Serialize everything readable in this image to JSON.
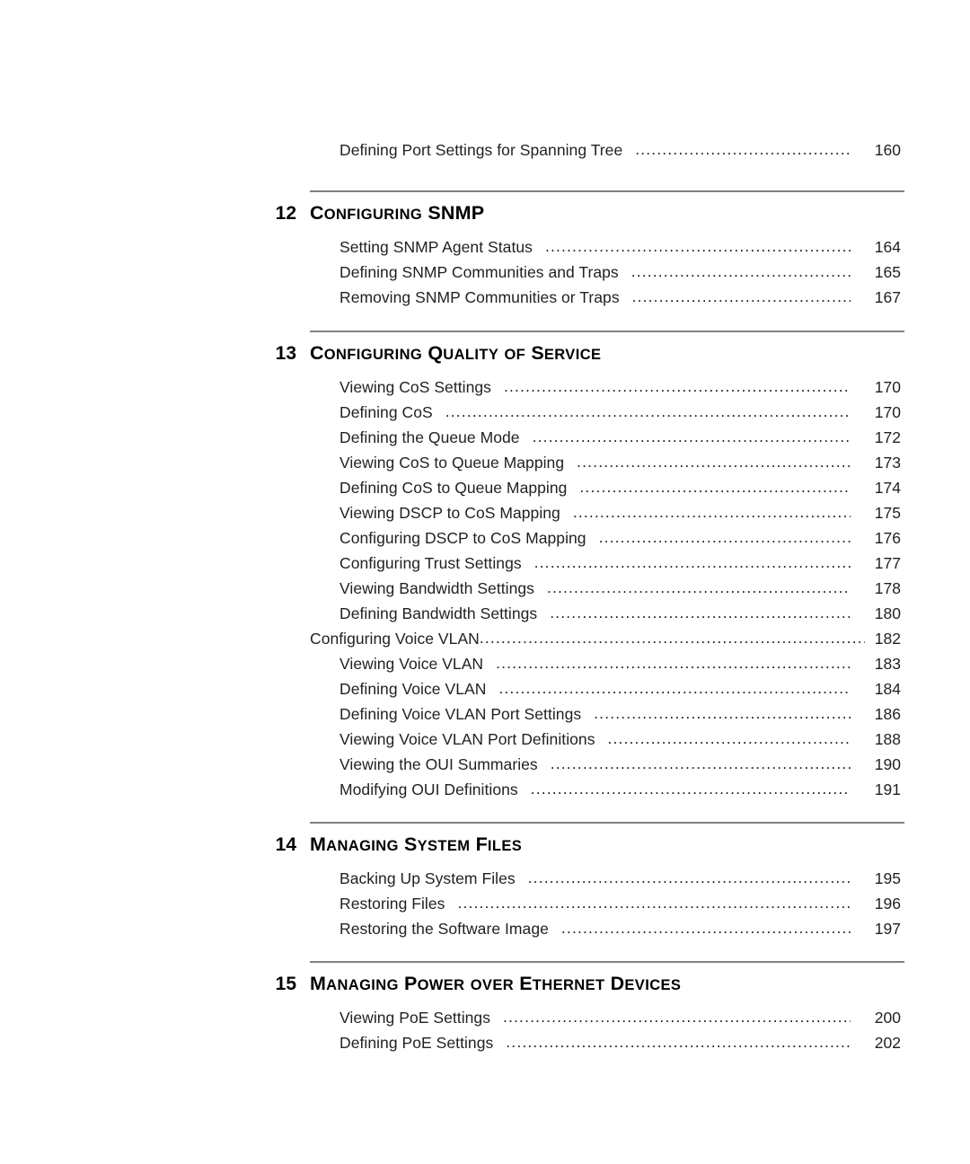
{
  "document": {
    "type": "table-of-contents",
    "rule_color": "#808285",
    "text_color": "#231f20"
  },
  "orphan_entries": [
    {
      "label": "Defining Port Settings for Spanning Tree",
      "page": "160"
    }
  ],
  "chapters": [
    {
      "number": "12",
      "title": "Configuring SNMP",
      "title_words": [
        {
          "cap": "C",
          "rest": "ONFIGURING"
        },
        {
          "cap": "SNMP",
          "rest": ""
        }
      ],
      "entries": [
        {
          "label": "Setting SNMP Agent Status",
          "page": "164",
          "style": "indent"
        },
        {
          "label": "Defining SNMP Communities and Traps",
          "page": "165",
          "style": "indent"
        },
        {
          "label": "Removing SNMP Communities or Traps",
          "page": "167",
          "style": "indent"
        }
      ]
    },
    {
      "number": "13",
      "title": "Configuring Quality of Service",
      "title_words": [
        {
          "cap": "C",
          "rest": "ONFIGURING"
        },
        {
          "cap": "Q",
          "rest": "UALITY"
        },
        {
          "cap": "",
          "rest": "OF"
        },
        {
          "cap": "S",
          "rest": "ERVICE"
        }
      ],
      "entries": [
        {
          "label": "Viewing CoS Settings",
          "page": "170",
          "style": "indent"
        },
        {
          "label": "Defining CoS",
          "page": "170",
          "style": "indent"
        },
        {
          "label": "Defining the Queue Mode",
          "page": "172",
          "style": "indent"
        },
        {
          "label": "Viewing CoS to Queue Mapping",
          "page": "173",
          "style": "indent"
        },
        {
          "label": "Defining CoS to Queue Mapping",
          "page": "174",
          "style": "indent"
        },
        {
          "label": "Viewing DSCP to CoS  Mapping",
          "page": "175",
          "style": "indent"
        },
        {
          "label": "Configuring DSCP to CoS Mapping",
          "page": "176",
          "style": "indent"
        },
        {
          "label": "Configuring Trust Settings",
          "page": "177",
          "style": "indent"
        },
        {
          "label": "Viewing Bandwidth Settings",
          "page": "178",
          "style": "indent"
        },
        {
          "label": "Defining Bandwidth Settings",
          "page": "180",
          "style": "indent"
        },
        {
          "label": "Configuring Voice VLAN",
          "page": "182",
          "style": "outdent"
        },
        {
          "label": "Viewing Voice VLAN",
          "page": "183",
          "style": "indent"
        },
        {
          "label": "Defining Voice VLAN",
          "page": "184",
          "style": "indent"
        },
        {
          "label": "Defining Voice VLAN Port Settings",
          "page": "186",
          "style": "indent"
        },
        {
          "label": "Viewing Voice VLAN Port Definitions",
          "page": "188",
          "style": "indent"
        },
        {
          "label": "Viewing the OUI Summaries",
          "page": "190",
          "style": "indent"
        },
        {
          "label": "Modifying OUI Definitions",
          "page": "191",
          "style": "indent"
        }
      ]
    },
    {
      "number": "14",
      "title": "Managing System Files",
      "title_words": [
        {
          "cap": "M",
          "rest": "ANAGING"
        },
        {
          "cap": "S",
          "rest": "YSTEM"
        },
        {
          "cap": "F",
          "rest": "ILES"
        }
      ],
      "entries": [
        {
          "label": "Backing Up System Files",
          "page": "195",
          "style": "indent"
        },
        {
          "label": "Restoring Files",
          "page": "196",
          "style": "indent"
        },
        {
          "label": "Restoring the Software Image",
          "page": "197",
          "style": "indent"
        }
      ]
    },
    {
      "number": "15",
      "title": "Managing Power over Ethernet Devices",
      "title_words": [
        {
          "cap": "M",
          "rest": "ANAGING"
        },
        {
          "cap": "P",
          "rest": "OWER"
        },
        {
          "cap": "",
          "rest": "OVER"
        },
        {
          "cap": "E",
          "rest": "THERNET"
        },
        {
          "cap": "D",
          "rest": "EVICES"
        }
      ],
      "entries": [
        {
          "label": "Viewing PoE Settings",
          "page": "200",
          "style": "indent"
        },
        {
          "label": "Defining PoE Settings",
          "page": "202",
          "style": "indent"
        }
      ]
    }
  ]
}
